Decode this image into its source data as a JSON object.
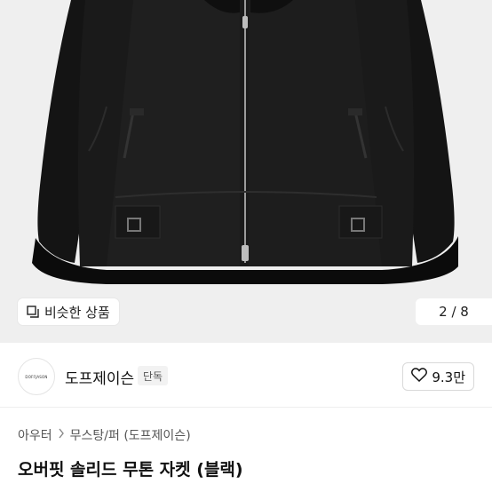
{
  "hero": {
    "image_alt": "black shearling aviator jacket",
    "similar_button_label": "비슷한 상품",
    "pager": "2 / 8",
    "icons": {
      "similar": "similar-products-icon"
    }
  },
  "brand": {
    "logo_text": "DOFFJASON",
    "name": "도프제이슨",
    "badge": "단독",
    "like_count": "9.3만",
    "icons": {
      "like": "heart-icon"
    }
  },
  "breadcrumb": {
    "items": [
      "아우터",
      "무스탕/퍼 (도프제이슨)"
    ],
    "separator_icon": "chevron-right-icon"
  },
  "product": {
    "title": "오버핏 솔리드 무톤 자켓 (블랙)"
  },
  "colors": {
    "hero_bg": "#efefef",
    "jacket": "#161616",
    "text": "#111111"
  }
}
